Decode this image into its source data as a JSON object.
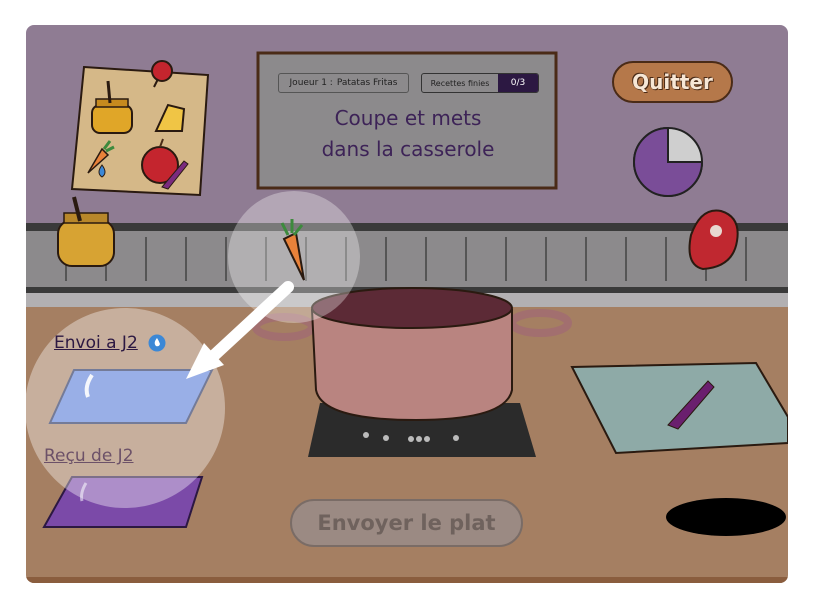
{
  "hud": {
    "player_label": "Joueur 1 :",
    "player_name": "Patatas Fritas",
    "recipes_label": "Recettes finies",
    "recipes_value": "0/3",
    "instruction_line1": "Coupe et mets",
    "instruction_line2": "dans la casserole"
  },
  "buttons": {
    "quit": "Quitter",
    "send_dish": "Envoyer le plat"
  },
  "stations": {
    "send_label": "Envoi a J2",
    "receive_label": "Reçu de J2"
  },
  "timer": {
    "elapsed_fraction": 0.25
  },
  "icons": {
    "recipe_card": [
      "honey-jar-icon",
      "cheese-icon",
      "carrot-icon",
      "water-drop-icon",
      "apple-icon",
      "knife-icon"
    ],
    "shelf": [
      "honey-jar-icon",
      "meat-icon"
    ],
    "held_item": "carrot-icon",
    "send_badge": "water-drop-icon",
    "cutting_board_tool": "knife-icon"
  },
  "colors": {
    "wall": "#8f7c93",
    "counter": "#a57f62",
    "accent_purple": "#7a4d98",
    "send_tray": "#5b7fd8",
    "receive_tray": "#7b4aa8",
    "cutting_board": "#8eaaa7",
    "pot": "#b98480",
    "quit_button": "#b5784a"
  }
}
